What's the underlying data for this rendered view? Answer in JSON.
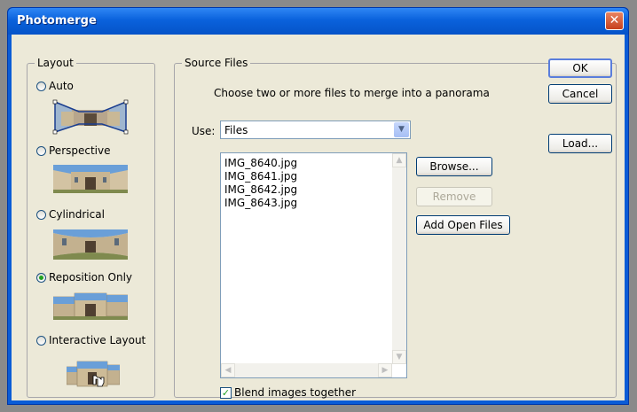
{
  "window": {
    "title": "Photomerge",
    "close_glyph": "✕"
  },
  "layout": {
    "legend": "Layout",
    "options": [
      {
        "label": "Auto",
        "checked": false
      },
      {
        "label": "Perspective",
        "checked": false
      },
      {
        "label": "Cylindrical",
        "checked": false
      },
      {
        "label": "Reposition Only",
        "checked": true
      },
      {
        "label": "Interactive Layout",
        "checked": false
      }
    ]
  },
  "source": {
    "legend": "Source Files",
    "instruction": "Choose two or more files to merge into a panorama",
    "use_label": "Use:",
    "use_value": "Files",
    "files": [
      "IMG_8640.jpg",
      "IMG_8641.jpg",
      "IMG_8642.jpg",
      "IMG_8643.jpg"
    ],
    "browse_label": "Browse...",
    "remove_label": "Remove",
    "add_open_label": "Add Open Files",
    "blend_label": "Blend images together",
    "blend_checked": true
  },
  "buttons": {
    "ok": "OK",
    "cancel": "Cancel",
    "load": "Load..."
  },
  "glyphs": {
    "dropdown": "▼",
    "scroll_up": "▲",
    "scroll_down": "▼",
    "scroll_left": "◀",
    "scroll_right": "▶",
    "check": "✓"
  },
  "colors": {
    "titlebar": "#0a5cd6",
    "client": "#ece9d8",
    "radio_dot": "#21a121"
  }
}
